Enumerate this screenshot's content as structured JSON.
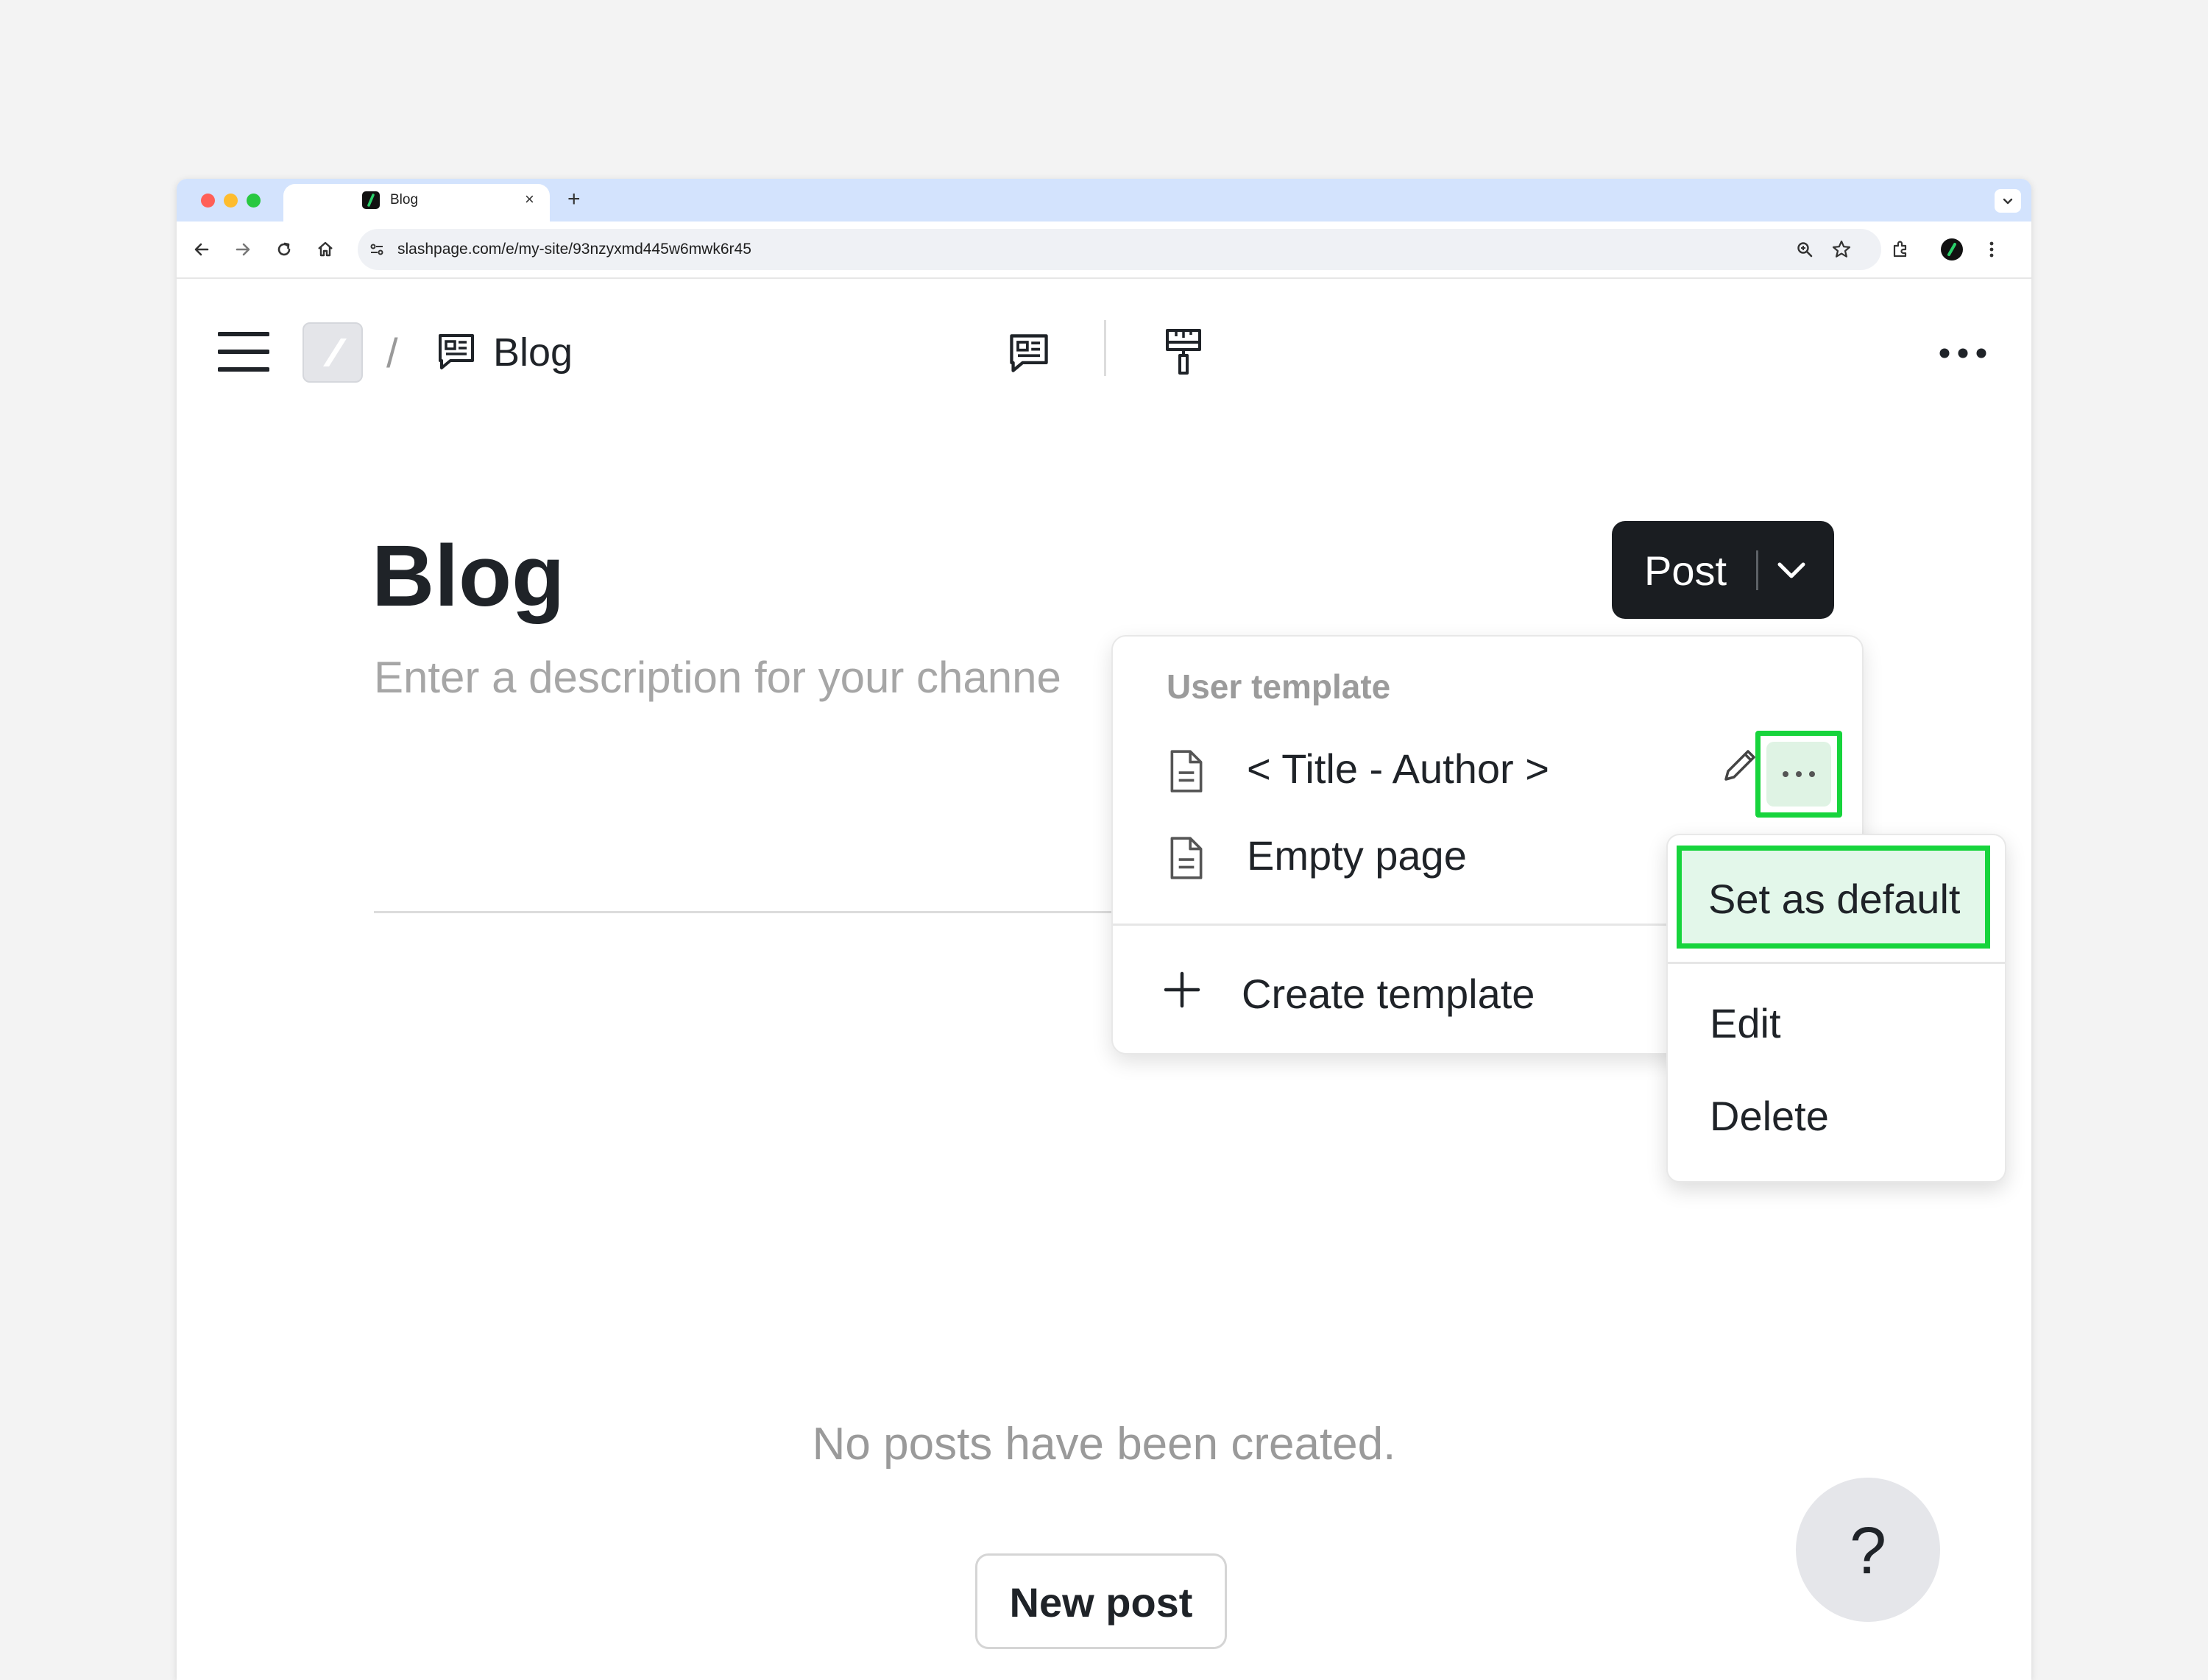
{
  "browser": {
    "tab_title": "Blog",
    "new_tab_symbol": "+",
    "close_symbol": "×",
    "url": "slashpage.com/e/my-site/93nzyxmd445w6mwk6r45"
  },
  "header": {
    "separator": "/",
    "channel_title": "Blog"
  },
  "page": {
    "title": "Blog",
    "description_placeholder": "Enter a description for your channe",
    "empty_message": "No posts have been created.",
    "new_post_label": "New post",
    "help_label": "?"
  },
  "post_button": {
    "label": "Post"
  },
  "template_menu": {
    "heading": "User template",
    "items": [
      {
        "label": "< Title - Author >"
      },
      {
        "label": "Empty page"
      }
    ],
    "create_label": "Create template"
  },
  "context_menu": {
    "items": [
      {
        "label": "Set as default"
      },
      {
        "label": "Edit"
      },
      {
        "label": "Delete"
      }
    ]
  },
  "colors": {
    "highlight": "#17d43c",
    "post_button_bg": "#1a1d21",
    "tabstrip": "#d3e3fd"
  }
}
